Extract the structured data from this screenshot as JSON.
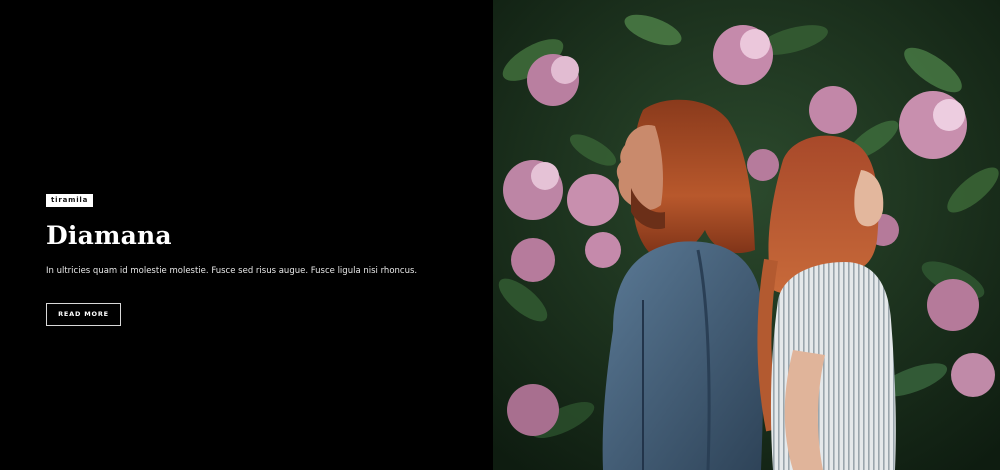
{
  "hero": {
    "tag": "tiramila",
    "title": "Diamana",
    "description": "In ultricies quam id molestie molestie. Fusce sed risus augue. Fusce ligula nisi rhoncus.",
    "button_label": "READ MORE"
  },
  "colors": {
    "background": "#000000",
    "text": "#ffffff",
    "foliage": "#1f3a22",
    "flower": "#c98fb0",
    "hair": "#b5532a",
    "denim": "#3c5670",
    "shirt": "#d9dee2"
  },
  "photo": {
    "subject": "couple-back-to-back-flowers"
  }
}
